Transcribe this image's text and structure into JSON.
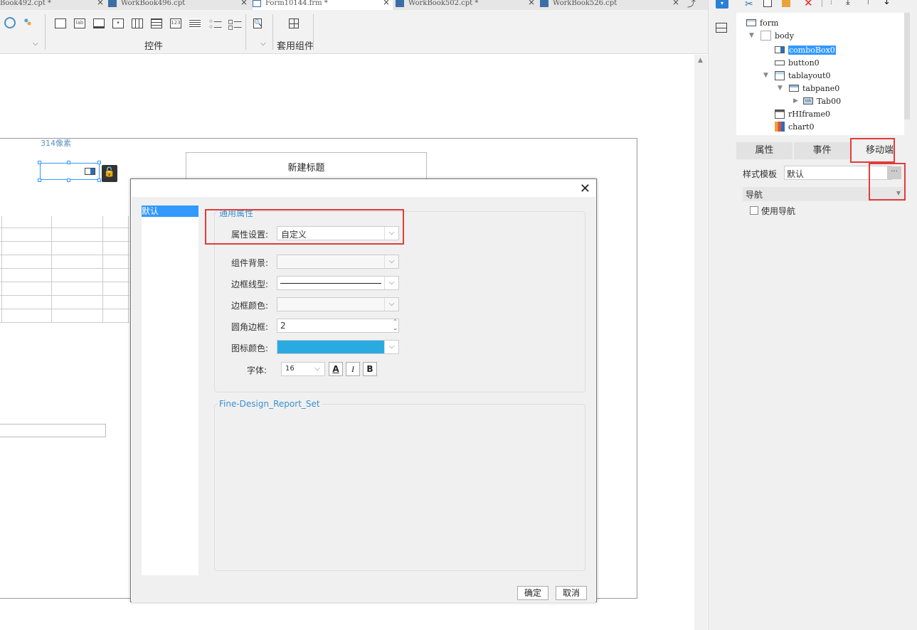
{
  "tabs": [
    {
      "label": "Book492.cpt *"
    },
    {
      "label": "WorkBook496.cpt"
    },
    {
      "label": "Form10144.frm *"
    },
    {
      "label": "WorkBook502.cpt *"
    },
    {
      "label": "WorkBook526.cpt"
    }
  ],
  "toolbar": {
    "controls_label": "控件",
    "preset_label": "套用组件",
    "lab_icon": "lab",
    "num_icon": "123"
  },
  "canvas": {
    "size_hint": "314像素",
    "title_widget": "新建标题"
  },
  "dialog": {
    "list_item": "默认",
    "section_general": "通用属性",
    "section_report": "Fine-Design_Report_Set",
    "prop_setting_label": "属性设置:",
    "prop_setting_value": "自定义",
    "bg_label": "组件背景:",
    "border_style_label": "边框线型:",
    "border_color_label": "边框颜色:",
    "radius_label": "圆角边框:",
    "radius_value": "2",
    "icon_color_label": "图标颜色:",
    "icon_color": "#29abe2",
    "font_label": "字体:",
    "font_size": "16",
    "font_color_btn": "A",
    "italic_btn": "I",
    "bold_btn": "B",
    "ok": "确定",
    "cancel": "取消"
  },
  "tree": {
    "form": "form",
    "body": "body",
    "combo": "comboBox0",
    "button": "button0",
    "tablayout": "tablayout0",
    "tabpane": "tabpane0",
    "tab": "Tab00",
    "iframe": "rHIframe0",
    "chart": "chart0",
    "tab_icon_text": "tab"
  },
  "right": {
    "tab_props": "属性",
    "tab_events": "事件",
    "tab_mobile": "移动端",
    "style_template_label": "样式模板",
    "style_template_value": "默认",
    "ellipsis": "···",
    "nav_section": "导航",
    "use_nav": "使用导航"
  },
  "colors": {
    "accent": "#29abe2",
    "highlight": "#e23c3c",
    "selection": "#3399ff"
  }
}
